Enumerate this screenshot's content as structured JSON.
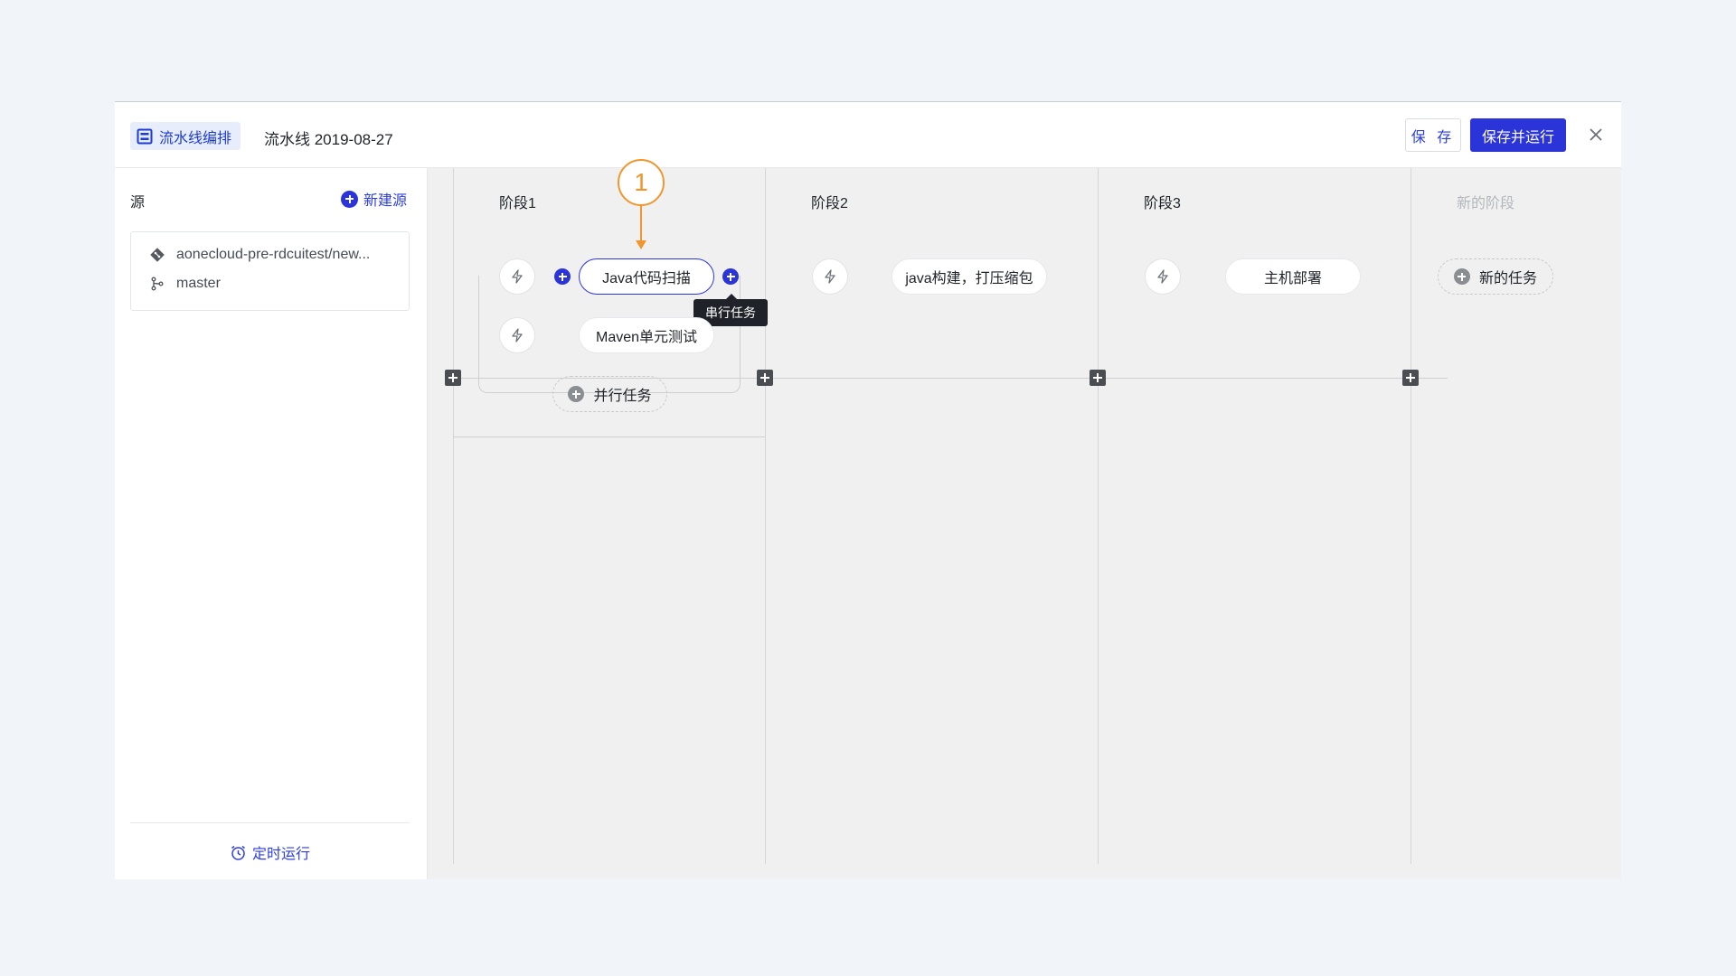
{
  "header": {
    "brand": "流水线编排",
    "pipeline_name": "流水线 2019-08-27",
    "save": "保 存",
    "save_and_run": "保存并运行"
  },
  "sidebar": {
    "title": "源",
    "new_source": "新建源",
    "source": {
      "repo": "aonecloud-pre-rdcuitest/new...",
      "branch": "master"
    },
    "schedule": "定时运行"
  },
  "stages": [
    {
      "label": "阶段1",
      "tasks": [
        "Java代码扫描",
        "Maven单元测试"
      ],
      "parallel_add": "并行任务"
    },
    {
      "label": "阶段2",
      "tasks": [
        "java构建，打压缩包"
      ]
    },
    {
      "label": "阶段3",
      "tasks": [
        "主机部署"
      ]
    },
    {
      "label": "新的阶段",
      "new_task": "新的任务"
    }
  ],
  "tooltip": "串行任务",
  "annotation": "1",
  "colors": {
    "accent": "#2b34d9",
    "annotation": "#f0962e",
    "canvas": "#f0f0f0"
  }
}
